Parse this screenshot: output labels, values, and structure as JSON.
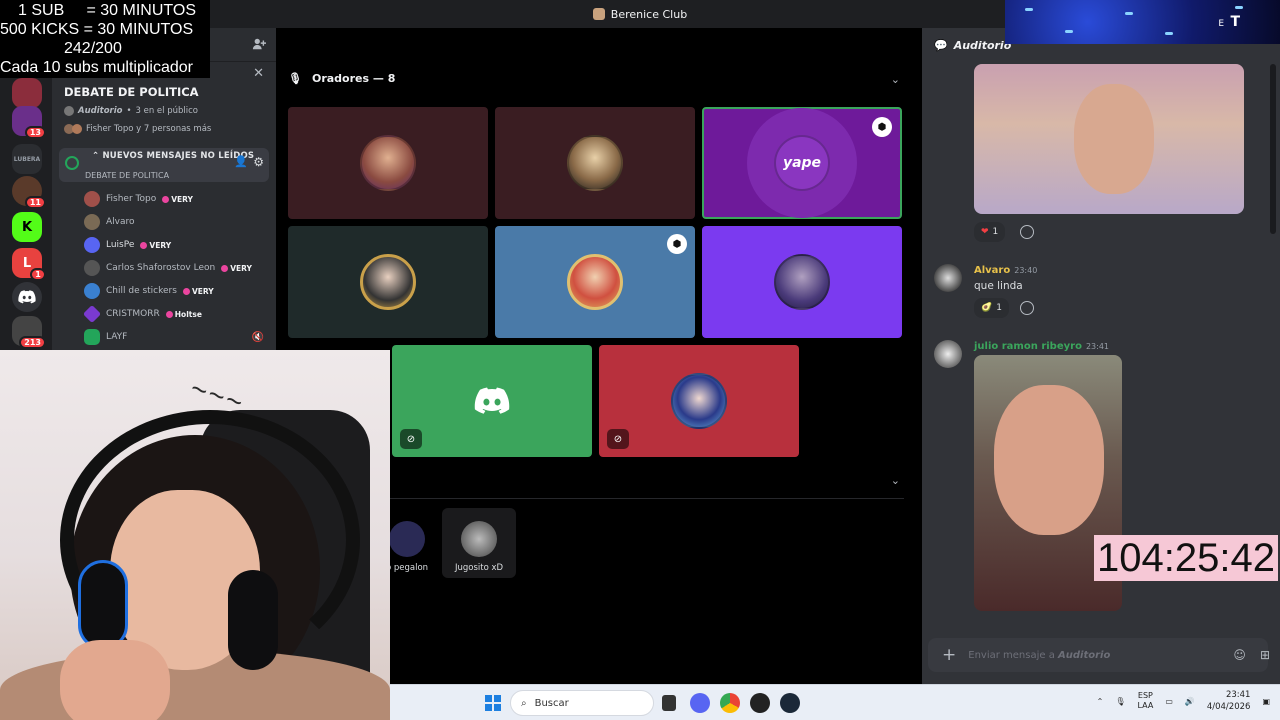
{
  "overlay": {
    "line1": "1 SUB     = 30 MINUTOS",
    "line2": "500 KICKS = 30 MINUTOS",
    "line3": "242/200",
    "line4": "Cada 10 subs multiplicador"
  },
  "window": {
    "title": "Berenice Club"
  },
  "rail": {
    "servers": [
      {
        "name": "server-1",
        "color": "#8b2d3c",
        "badge": ""
      },
      {
        "name": "server-2",
        "color": "#6a2f8a",
        "badge": "13"
      },
      {
        "name": "server-3",
        "color": "#2b2d31",
        "badge": ""
      },
      {
        "name": "server-4",
        "color": "#5a3a2a",
        "badge": "11"
      },
      {
        "name": "server-kick",
        "color": "#53fc18",
        "badge": ""
      },
      {
        "name": "server-5",
        "color": "#e8423f",
        "badge": "1"
      },
      {
        "name": "server-discord",
        "color": "#313338",
        "badge": ""
      },
      {
        "name": "server-6",
        "color": "#444",
        "badge": "213"
      }
    ]
  },
  "sidebar": {
    "event_title": "DEBATE DE POLITICA",
    "event_channel": "Auditorio",
    "event_audience": "3 en el público",
    "event_people": "Fisher Topo y 7 personas más",
    "unread_banner": "NUEVOS MENSAJES NO LEÍDOS",
    "rail_label": "LUBERA",
    "channel_name": "DEBATE DE POLITICA",
    "members": [
      {
        "name": "Fisher Topo",
        "tag": "VERY",
        "color": "#a0504a"
      },
      {
        "name": "Alvaro",
        "tag": "",
        "color": "#7a6a55"
      },
      {
        "name": "LuisPe",
        "tag": "VERY",
        "color": "#5865f2"
      },
      {
        "name": "Carlos Shaforostov Leon",
        "tag": "VERY",
        "color": "#555"
      },
      {
        "name": "Chill de stickers",
        "tag": "VERY",
        "color": "#3a80d0"
      },
      {
        "name": "CRISTMORR",
        "tag": "Holtse",
        "color": "#7a3ad0"
      },
      {
        "name": "LAYF",
        "tag": "",
        "color": "#23a55a"
      }
    ]
  },
  "stage": {
    "speakers_label": "Oradores — 8",
    "speakers": [
      {
        "name": "speaker-1",
        "bg": "#3a1d22",
        "av": "#8a4a40",
        "mod": false,
        "muted": false
      },
      {
        "name": "speaker-2",
        "bg": "#3a1d22",
        "av": "#c9a070",
        "mod": false,
        "muted": false
      },
      {
        "name": "speaker-yape",
        "bg": "#6e1a9a",
        "av": "#7a2ab0",
        "mod": true,
        "muted": false
      },
      {
        "name": "speaker-3",
        "bg": "#1f2a2a",
        "av": "#d0b070",
        "mod": false,
        "muted": false
      },
      {
        "name": "speaker-4",
        "bg": "#4a7aa8",
        "av": "#d05040",
        "mod": true,
        "muted": false
      },
      {
        "name": "speaker-5",
        "bg": "#7b3af0",
        "av": "#4a3a7a",
        "mod": false,
        "muted": false
      },
      {
        "name": "speaker-discord",
        "bg": "#3ba55c",
        "av": "#3ba55c",
        "mod": false,
        "muted": true
      },
      {
        "name": "speaker-6",
        "bg": "#b8303d",
        "av": "#2a3a8a",
        "mod": false,
        "muted": true
      }
    ],
    "audience": [
      {
        "name": "o pegalon",
        "color": "#2a2a55"
      },
      {
        "name": "Jugosito xD",
        "color": "#888"
      }
    ]
  },
  "chat": {
    "channel": "Auditorio",
    "messages": [
      {
        "author": "Alvaro",
        "time": "23:40",
        "text": "que linda",
        "color": "#e7c14a"
      },
      {
        "author": "julio ramon ribeyro",
        "time": "23:41",
        "text": "",
        "color": "#3ba55c"
      }
    ],
    "reactions": [
      {
        "emoji": "❤",
        "count": "1"
      },
      {
        "emoji": "🥑",
        "count": "1"
      }
    ],
    "composer_placeholder": "Enviar mensaje a",
    "composer_channel": "Auditorio"
  },
  "timer": "104:25:42",
  "topcam": {
    "text": "T",
    "small": "E"
  },
  "taskbar": {
    "search_placeholder": "Buscar",
    "lang_top": "ESP",
    "lang_bottom": "LAA",
    "time": "23:41",
    "date": "4/04/2026"
  }
}
